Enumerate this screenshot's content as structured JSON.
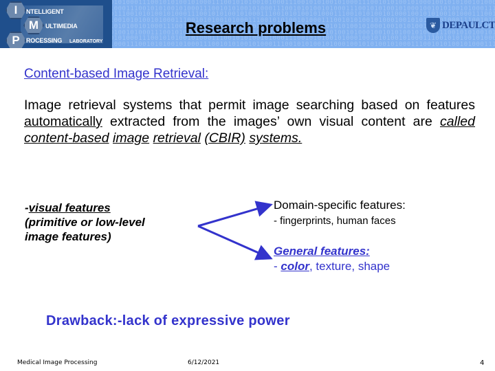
{
  "header": {
    "logo": {
      "letters": [
        "I",
        "M",
        "P"
      ],
      "words": [
        "NTELLIGENT",
        "ULTIMEDIA",
        "ROCESSING"
      ],
      "lab": "LABORATORY"
    },
    "title": "Research problems",
    "partner_logo": "DEPAULCTI",
    "partner_icon": "shield-icon",
    "binary_pattern": "1001010100101000111001010100101000111001010100101000111001010100101000111001010100101000111001010100101000"
  },
  "heading": "Content-based Image Retrieval:",
  "paragraph": {
    "part1": "Image retrieval systems that permit image searching based on features ",
    "emph1": "automatically",
    "part2": " extracted from the images’ own visual content are ",
    "italic_words": [
      "called",
      "content-based",
      "image",
      "retrieval",
      "(CBIR)",
      "systems."
    ]
  },
  "left_block": {
    "prefix": "-",
    "title": "visual features",
    "line2": "(primitive or low-level",
    "line3": "image features)"
  },
  "domain_specific": {
    "title": "Domain-specific features:",
    "items": "- fingerprints, human faces"
  },
  "general": {
    "title": "General features:",
    "prefix": "- ",
    "color_word": "color",
    "rest": ", texture, shape"
  },
  "drawback": "Drawback:-lack of expressive power",
  "footer": {
    "left": "Medical Image Processing",
    "date": "6/12/2021",
    "page": "4"
  },
  "colors": {
    "accent_blue": "#3333cc",
    "header_blue": "#7fb0f0",
    "logo_navy": "#1f4f8c"
  }
}
